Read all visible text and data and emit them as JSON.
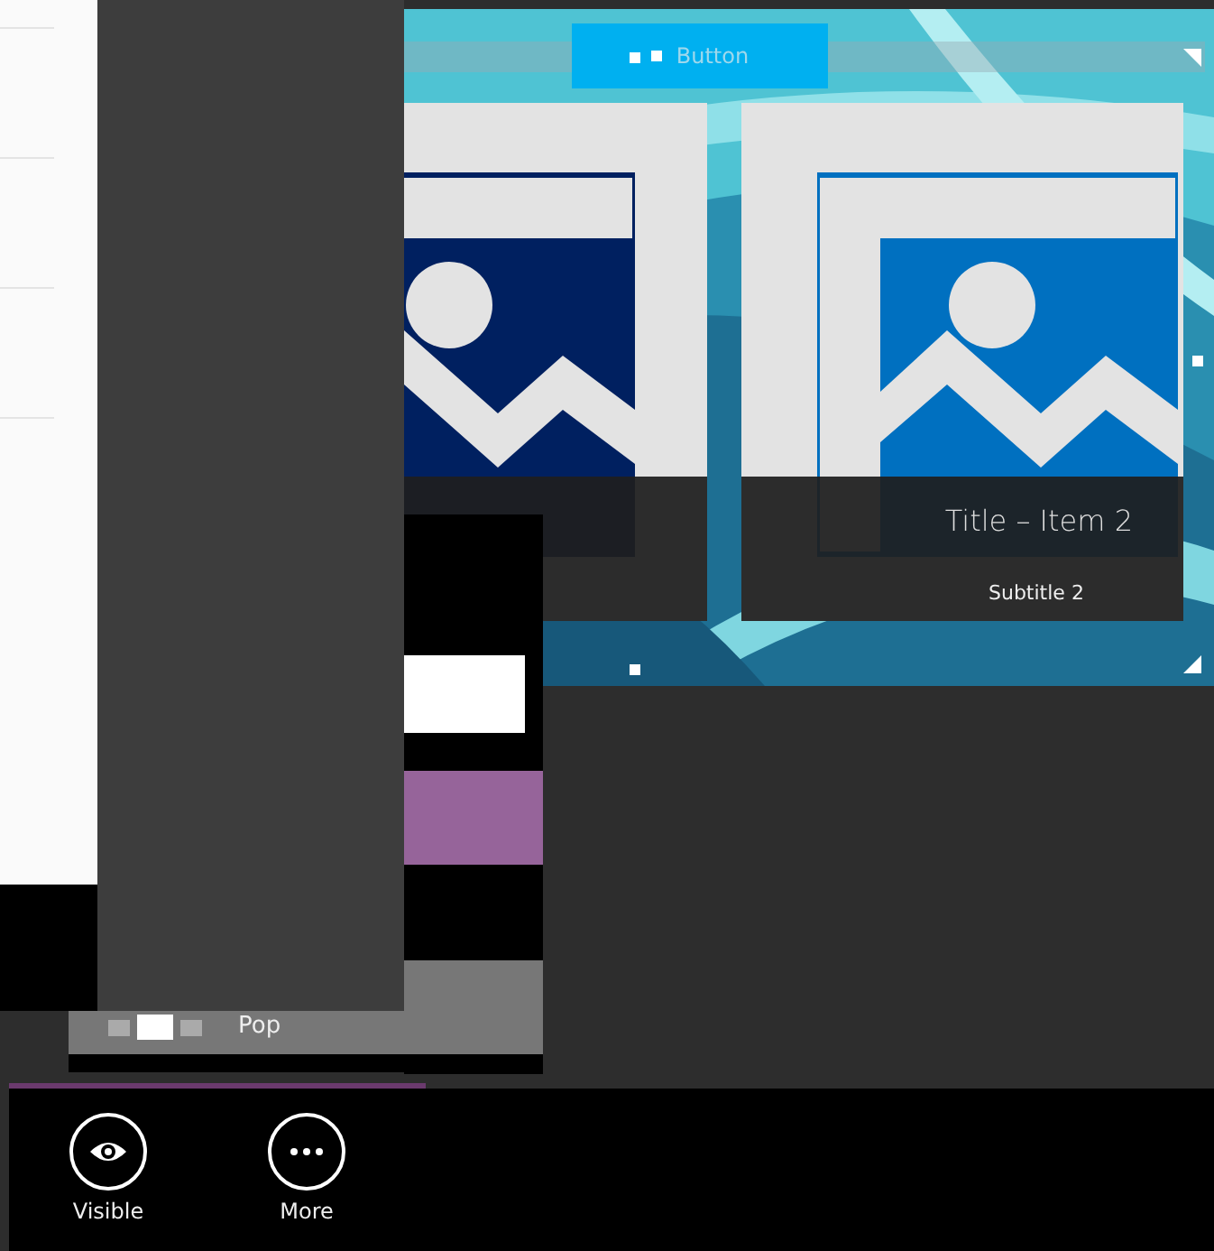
{
  "designer": {
    "button": {
      "label": "Button"
    },
    "tiles": [
      {
        "color": "#002060"
      },
      {
        "color": "#0070c0",
        "title": "Title – Item 2",
        "subtitle": "Subtitle 2"
      }
    ],
    "pop": {
      "label": "Pop"
    }
  },
  "app_bar": {
    "buttons": [
      {
        "kind": "eye",
        "label": "Visible"
      },
      {
        "kind": "more",
        "label": "More"
      }
    ]
  }
}
